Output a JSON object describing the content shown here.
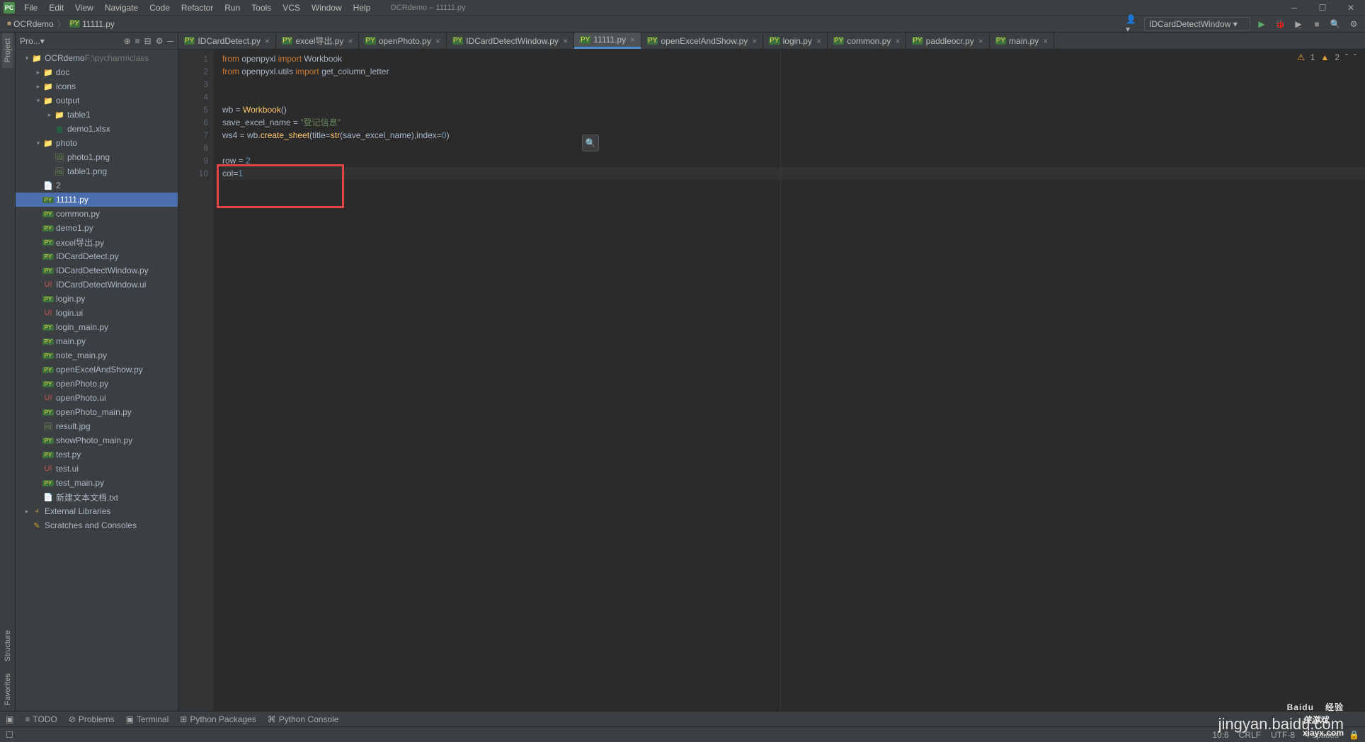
{
  "window": {
    "title": "OCRdemo – 11111.py",
    "app_icon": "PC"
  },
  "menu": [
    "File",
    "Edit",
    "View",
    "Navigate",
    "Code",
    "Refactor",
    "Run",
    "Tools",
    "VCS",
    "Window",
    "Help"
  ],
  "breadcrumb": [
    {
      "label": "OCRdemo",
      "icon": "folder"
    },
    {
      "label": "11111.py",
      "icon": "py"
    }
  ],
  "run_config": "IDCardDetectWindow",
  "project_header": "Pro...",
  "tree": [
    {
      "d": 0,
      "exp": "▾",
      "icon": "folder",
      "label": "OCRdemo",
      "suffix": "F:\\pycharm\\class"
    },
    {
      "d": 1,
      "exp": "▸",
      "icon": "folder",
      "label": "doc"
    },
    {
      "d": 1,
      "exp": "▸",
      "icon": "folder",
      "label": "icons"
    },
    {
      "d": 1,
      "exp": "▾",
      "icon": "folder",
      "label": "output"
    },
    {
      "d": 2,
      "exp": "▸",
      "icon": "folder",
      "label": "table1"
    },
    {
      "d": 2,
      "exp": " ",
      "icon": "xls",
      "label": "demo1.xlsx"
    },
    {
      "d": 1,
      "exp": "▾",
      "icon": "folder",
      "label": "photo"
    },
    {
      "d": 2,
      "exp": " ",
      "icon": "img",
      "label": "photo1.png"
    },
    {
      "d": 2,
      "exp": " ",
      "icon": "img",
      "label": "table1.png"
    },
    {
      "d": 1,
      "exp": " ",
      "icon": "txt",
      "label": "2"
    },
    {
      "d": 1,
      "exp": " ",
      "icon": "py",
      "label": "11111.py",
      "selected": true
    },
    {
      "d": 1,
      "exp": " ",
      "icon": "py",
      "label": "common.py"
    },
    {
      "d": 1,
      "exp": " ",
      "icon": "py",
      "label": "demo1.py"
    },
    {
      "d": 1,
      "exp": " ",
      "icon": "py",
      "label": "excel导出.py"
    },
    {
      "d": 1,
      "exp": " ",
      "icon": "py",
      "label": "IDCardDetect.py"
    },
    {
      "d": 1,
      "exp": " ",
      "icon": "py",
      "label": "IDCardDetectWindow.py"
    },
    {
      "d": 1,
      "exp": " ",
      "icon": "ui",
      "label": "IDCardDetectWindow.ui"
    },
    {
      "d": 1,
      "exp": " ",
      "icon": "py",
      "label": "login.py"
    },
    {
      "d": 1,
      "exp": " ",
      "icon": "ui",
      "label": "login.ui"
    },
    {
      "d": 1,
      "exp": " ",
      "icon": "py",
      "label": "login_main.py"
    },
    {
      "d": 1,
      "exp": " ",
      "icon": "py",
      "label": "main.py"
    },
    {
      "d": 1,
      "exp": " ",
      "icon": "py",
      "label": "note_main.py"
    },
    {
      "d": 1,
      "exp": " ",
      "icon": "py",
      "label": "openExcelAndShow.py"
    },
    {
      "d": 1,
      "exp": " ",
      "icon": "py",
      "label": "openPhoto.py"
    },
    {
      "d": 1,
      "exp": " ",
      "icon": "ui",
      "label": "openPhoto.ui"
    },
    {
      "d": 1,
      "exp": " ",
      "icon": "py",
      "label": "openPhoto_main.py"
    },
    {
      "d": 1,
      "exp": " ",
      "icon": "img",
      "label": "result.jpg"
    },
    {
      "d": 1,
      "exp": " ",
      "icon": "py",
      "label": "showPhoto_main.py"
    },
    {
      "d": 1,
      "exp": " ",
      "icon": "py",
      "label": "test.py"
    },
    {
      "d": 1,
      "exp": " ",
      "icon": "ui",
      "label": "test.ui"
    },
    {
      "d": 1,
      "exp": " ",
      "icon": "py",
      "label": "test_main.py"
    },
    {
      "d": 1,
      "exp": " ",
      "icon": "txt",
      "label": "新建文本文档.txt"
    },
    {
      "d": 0,
      "exp": "▸",
      "icon": "lib",
      "label": "External Libraries"
    },
    {
      "d": 0,
      "exp": " ",
      "icon": "scratch",
      "label": "Scratches and Consoles"
    }
  ],
  "tabs": [
    {
      "label": "IDCardDetect.py"
    },
    {
      "label": "excel导出.py"
    },
    {
      "label": "openPhoto.py"
    },
    {
      "label": "IDCardDetectWindow.py"
    },
    {
      "label": "11111.py",
      "active": true
    },
    {
      "label": "openExcelAndShow.py"
    },
    {
      "label": "login.py"
    },
    {
      "label": "common.py"
    },
    {
      "label": "paddleocr.py"
    },
    {
      "label": "main.py"
    }
  ],
  "code_lines": [
    {
      "n": 1,
      "html": "<span class='kw'>from</span> openpyxl <span class='kw'>import</span> Workbook"
    },
    {
      "n": 2,
      "html": "<span class='kw'>from</span> openpyxl.utils <span class='kw'>import</span> get_column_letter"
    },
    {
      "n": 3,
      "html": ""
    },
    {
      "n": 4,
      "html": ""
    },
    {
      "n": 5,
      "html": "wb = <span class='fn'>Workbook</span>()"
    },
    {
      "n": 6,
      "html": "save_excel_name = <span class='str'>\"登记信息\"</span>"
    },
    {
      "n": 7,
      "html": "ws4 = wb.<span class='fn'>create_sheet</span>(title=<span class='fn'>str</span>(save_excel_name),index=<span class='num'>0</span>)"
    },
    {
      "n": 8,
      "html": ""
    },
    {
      "n": 9,
      "html": "row = <span class='num'>2</span>"
    },
    {
      "n": 10,
      "html": "col=<span class='num'>1</span>",
      "current": true
    }
  ],
  "inspections": {
    "warn1": "1",
    "warn2": "2"
  },
  "left_tools": [
    "Project",
    "Structure",
    "Favorites"
  ],
  "bottom_tools": [
    "TODO",
    "Problems",
    "Terminal",
    "Python Packages",
    "Python Console"
  ],
  "status": {
    "pos": "10:6",
    "sep": "CRLF",
    "enc": "UTF-8",
    "indent": "4 spaces"
  },
  "watermark": {
    "brand": "Baidu",
    "brand_suffix": "经验",
    "url": "jingyan.baidu.com",
    "corner": "侠游戏",
    "corner_url": "xiayx.com"
  }
}
